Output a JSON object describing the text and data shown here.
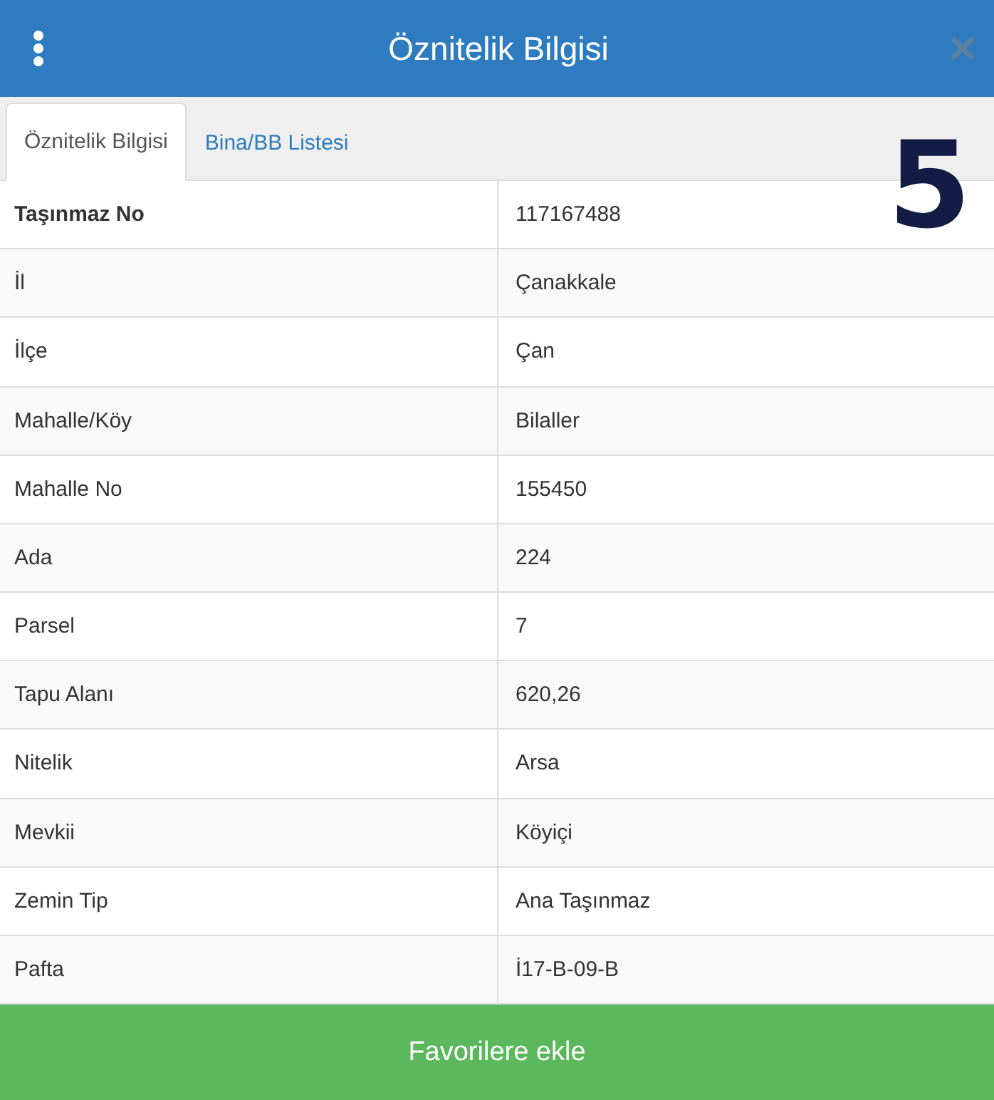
{
  "header": {
    "title": "Öznitelik Bilgisi"
  },
  "tabs": [
    {
      "label": "Öznitelik Bilgisi",
      "selected": true
    },
    {
      "label": "Bina/BB Listesi",
      "selected": false
    }
  ],
  "step_number": "5",
  "rows": [
    {
      "label": "Taşınmaz No",
      "value": "117167488",
      "bold": true
    },
    {
      "label": "İl",
      "value": "Çanakkale",
      "bold": false
    },
    {
      "label": "İlçe",
      "value": "Çan",
      "bold": false
    },
    {
      "label": "Mahalle/Köy",
      "value": "Bilaller",
      "bold": false
    },
    {
      "label": "Mahalle No",
      "value": "155450",
      "bold": false
    },
    {
      "label": "Ada",
      "value": "224",
      "bold": false
    },
    {
      "label": "Parsel",
      "value": "7",
      "bold": false
    },
    {
      "label": "Tapu Alanı",
      "value": "620,26",
      "bold": false
    },
    {
      "label": "Nitelik",
      "value": "Arsa",
      "bold": false
    },
    {
      "label": "Mevkii",
      "value": "Köyiçi",
      "bold": false
    },
    {
      "label": "Zemin Tip",
      "value": "Ana Taşınmaz",
      "bold": false
    },
    {
      "label": "Pafta",
      "value": "İ17-B-09-B",
      "bold": false
    }
  ],
  "footer_button": "Favorilere ekle"
}
